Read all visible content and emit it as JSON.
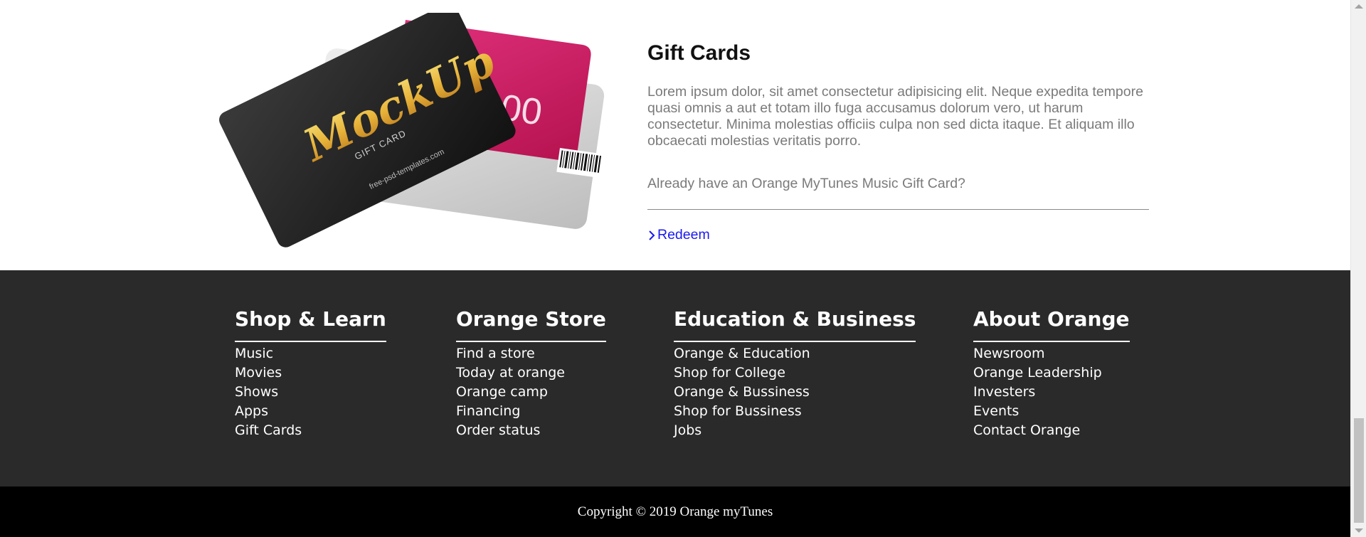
{
  "gift": {
    "title": "Gift Cards",
    "body": "Lorem ipsum dolor, sit amet consectetur adipisicing elit. Neque expedita tempore quasi omnis a aut et totam illo fuga accusamus dolorum vero, ut harum consectetur. Minima molestias officiis culpa non sed dicta itaque. Et aliquam illo obcaecati molestias veritatis porro.",
    "question": "Already have an Orange MyTunes Music Gift Card?",
    "redeem_label": "Redeem",
    "card": {
      "brand": "MockUp",
      "subtitle": "GIFT CARD",
      "site": "free-psd-templates.com",
      "amount": "00"
    }
  },
  "footer": {
    "columns": [
      {
        "heading": "Shop & Learn",
        "links": [
          "Music",
          "Movies",
          "Shows",
          "Apps",
          "Gift Cards"
        ]
      },
      {
        "heading": "Orange Store",
        "links": [
          "Find a store",
          "Today at orange",
          "Orange camp",
          "Financing",
          "Order status"
        ]
      },
      {
        "heading": "Education & Business",
        "links": [
          "Orange & Education",
          "Shop for College",
          "Orange & Bussiness",
          "Shop for Bussiness",
          "Jobs"
        ]
      },
      {
        "heading": "About Orange",
        "links": [
          "Newsroom",
          "Orange Leadership",
          "Investers",
          "Events",
          "Contact Orange"
        ]
      }
    ],
    "copyright": "Copyright © 2019 Orange myTunes"
  },
  "colors": {
    "footer_bg": "#2a2a2a",
    "copyright_bg": "#000000",
    "link": "#1a1aee",
    "card_pink": "#d81b6b",
    "card_gold": "#e8b43a"
  }
}
